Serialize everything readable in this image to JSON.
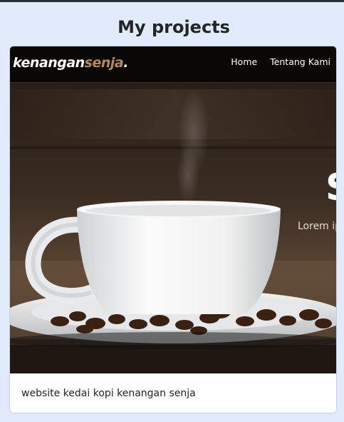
{
  "section": {
    "title": "My projects"
  },
  "project": {
    "preview": {
      "brand": {
        "main": "kenangan",
        "accent": "senja",
        "dot": "."
      },
      "nav": [
        "Home",
        "Tentang Kami"
      ],
      "hero_heading": "S",
      "hero_subtext": "Lorem ip"
    },
    "caption": "website kedai kopi kenangan senja"
  },
  "colors": {
    "page_bg": "#e1ebfb",
    "brand_accent": "#b6895b",
    "card_bg": "#ffffff"
  }
}
